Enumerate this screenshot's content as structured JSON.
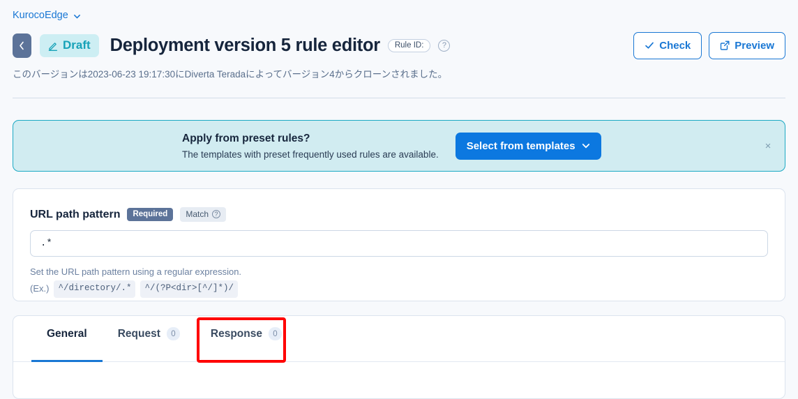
{
  "breadcrumb": {
    "label": "KurocoEdge",
    "chevron_icon": "chevron-down-icon"
  },
  "header": {
    "back_icon": "chevron-left-icon",
    "status_badge": {
      "label": "Draft",
      "icon": "pencil-icon",
      "bg_color": "#cdeef3",
      "text_color": "#17a2b8"
    },
    "title": "Deployment version 5 rule editor",
    "rule_id_badge": "Rule ID:",
    "help_icon_glyph": "?",
    "actions": [
      {
        "label": "Check",
        "icon": "check-icon"
      },
      {
        "label": "Preview",
        "icon": "external-link-icon"
      }
    ]
  },
  "clone_note": "このバージョンは2023-06-23 19:17:30にDiverta Teradaによってバージョン4からクローンされました。",
  "banner": {
    "title": "Apply from preset rules?",
    "subtitle": "The templates with preset frequently used rules are available.",
    "button_label": "Select from templates",
    "button_icon": "chevron-down-icon",
    "close_glyph": "×",
    "bg_color": "#d1ecf1",
    "border_color": "#1ba9c4",
    "button_color": "#0c78e0"
  },
  "url_field": {
    "label": "URL path pattern",
    "required_badge": "Required",
    "match_badge": "Match",
    "match_help_glyph": "?",
    "value": ".*",
    "placeholder": "",
    "help_line1": "Set the URL path pattern using a regular expression.",
    "help_prefix": "(Ex.)",
    "examples": [
      "^/directory/.*",
      "^/(?P<dir>[^/]*)/"
    ]
  },
  "tabs": [
    {
      "label": "General",
      "count": "",
      "active": true
    },
    {
      "label": "Request",
      "count": "0",
      "active": false
    },
    {
      "label": "Response",
      "count": "0",
      "active": false
    }
  ],
  "annotation": {
    "target": "Response",
    "color": "#ff0000"
  }
}
